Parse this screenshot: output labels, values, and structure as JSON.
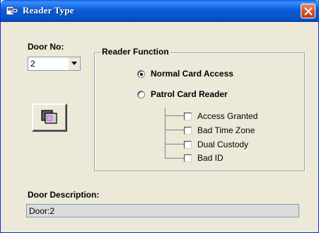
{
  "window": {
    "title": "Reader Type"
  },
  "door_no": {
    "label": "Door No:",
    "value": "2"
  },
  "reader_function": {
    "group_title": "Reader Function",
    "options": [
      {
        "label": "Normal Card Access",
        "selected": true
      },
      {
        "label": "Patrol Card Reader",
        "selected": false
      }
    ],
    "patrol_checks": [
      {
        "label": "Access Granted",
        "checked": false
      },
      {
        "label": "Bad Time Zone",
        "checked": false
      },
      {
        "label": "Dual Custody",
        "checked": false
      },
      {
        "label": "Bad ID",
        "checked": false
      }
    ]
  },
  "door_description": {
    "label": "Door Description:",
    "value": "Door:2"
  },
  "colors": {
    "titlebar": "#0a5cd8",
    "close_button": "#d9542c",
    "dialog_background": "#ece9d8"
  },
  "icons": {
    "title": "card-reader-icon",
    "close": "close-icon",
    "combo_arrow": "chevron-down-icon",
    "card_button": "card-reader-icon"
  }
}
